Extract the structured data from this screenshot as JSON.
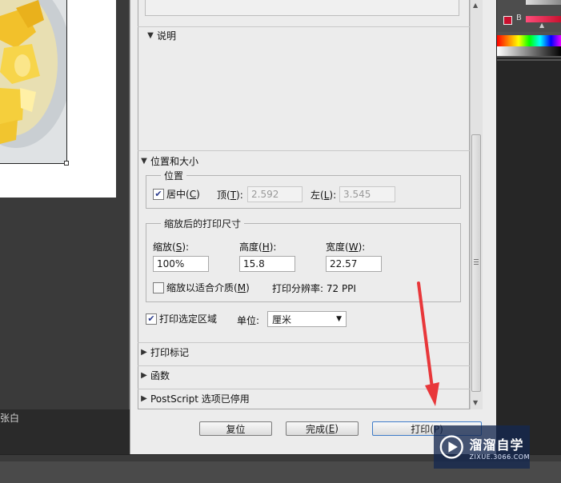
{
  "preview": {
    "bottom_text": "张白"
  },
  "sections": {
    "description": "说明",
    "position_size": "位置和大小",
    "print_marks": "打印标记",
    "functions": "函数",
    "postscript": "PostScript 选项已停用"
  },
  "position": {
    "legend": "位置",
    "center_label": "居中",
    "center_key": "C",
    "center_checked": true,
    "top_label": "顶",
    "top_key": "T",
    "top_value": "2.592",
    "left_label": "左",
    "left_key": "L",
    "left_value": "3.545"
  },
  "scaled_size": {
    "legend": "缩放后的打印尺寸",
    "scale_label": "缩放",
    "scale_key": "S",
    "scale_value": "100%",
    "height_label": "高度",
    "height_key": "H",
    "height_value": "15.8",
    "width_label": "宽度",
    "width_key": "W",
    "width_value": "22.57",
    "fit_media_label": "缩放以适合介质",
    "fit_media_key": "M",
    "fit_media_checked": false,
    "resolution_text": "打印分辨率: 72 PPI"
  },
  "print_area": {
    "label": "打印选定区域",
    "checked": true,
    "unit_label": "单位:",
    "unit_value": "厘米"
  },
  "buttons": {
    "reset": "复位",
    "done": "完成(",
    "done_key": "E",
    "done_end": ")",
    "print": "打印(P)"
  },
  "right_panel": {
    "channel_label": "B"
  },
  "watermark": {
    "title": "溜溜自学",
    "url": "ZIXUE.3066.COM"
  },
  "colors": {
    "arrow": "#e8373a",
    "dialog_bg": "#ececec",
    "dark_bg": "#3a3a3a"
  }
}
